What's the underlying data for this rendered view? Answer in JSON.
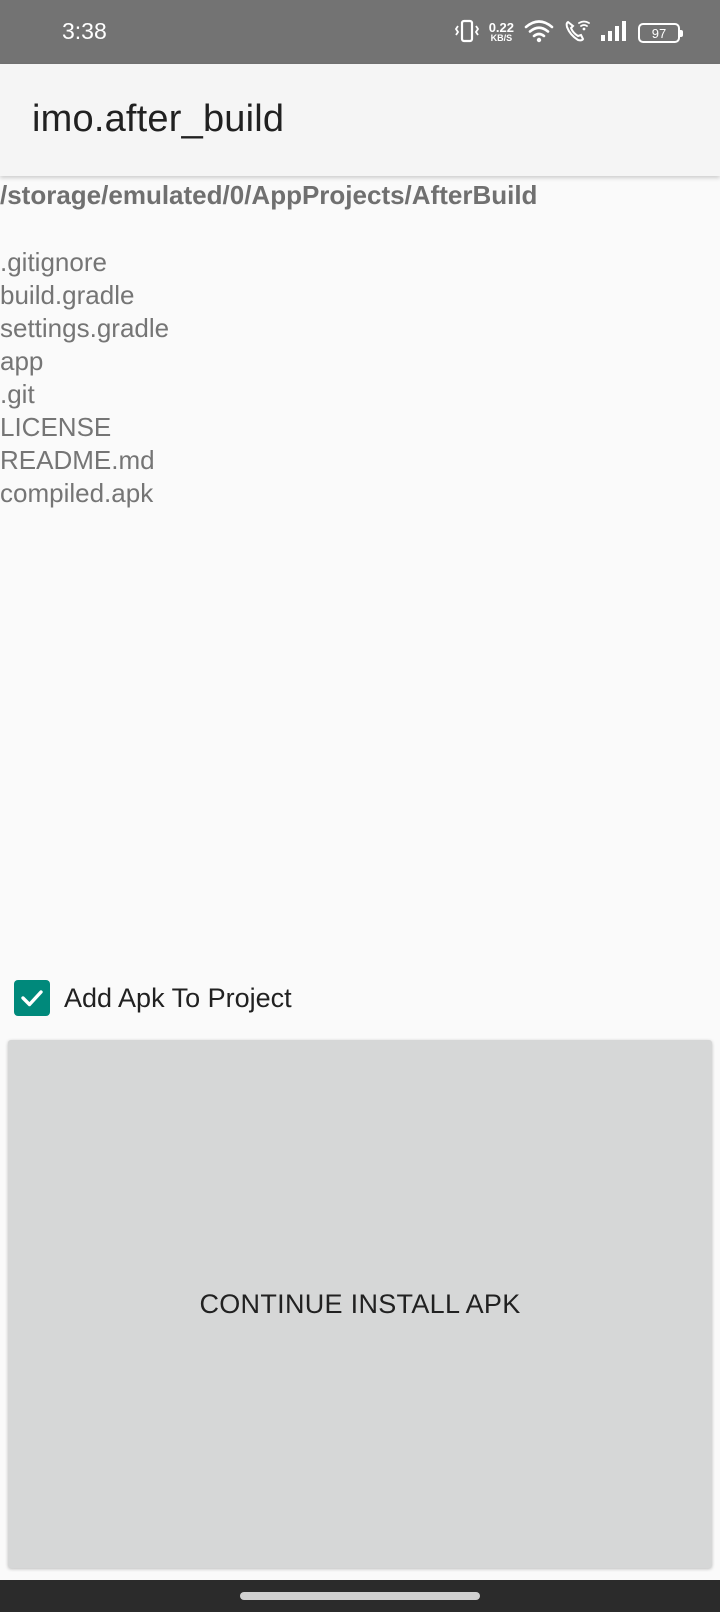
{
  "status_bar": {
    "time": "3:38",
    "net_speed": "0.22",
    "net_speed_unit": "KB/S",
    "battery": "97",
    "icons": [
      "vibrate-icon",
      "wifi-icon",
      "wifi-call-icon",
      "signal-icon",
      "battery-icon"
    ]
  },
  "app_bar": {
    "title": "imo.after_build"
  },
  "path": "/storage/emulated/0/AppProjects/AfterBuild",
  "files": [
    ".gitignore",
    "build.gradle",
    "settings.gradle",
    "app",
    ".git",
    "LICENSE",
    "README.md",
    "compiled.apk"
  ],
  "checkbox": {
    "label": "Add Apk To Project",
    "checked": true,
    "color": "#00897b"
  },
  "install_button": {
    "label": "CONTINUE INSTALL APK"
  }
}
